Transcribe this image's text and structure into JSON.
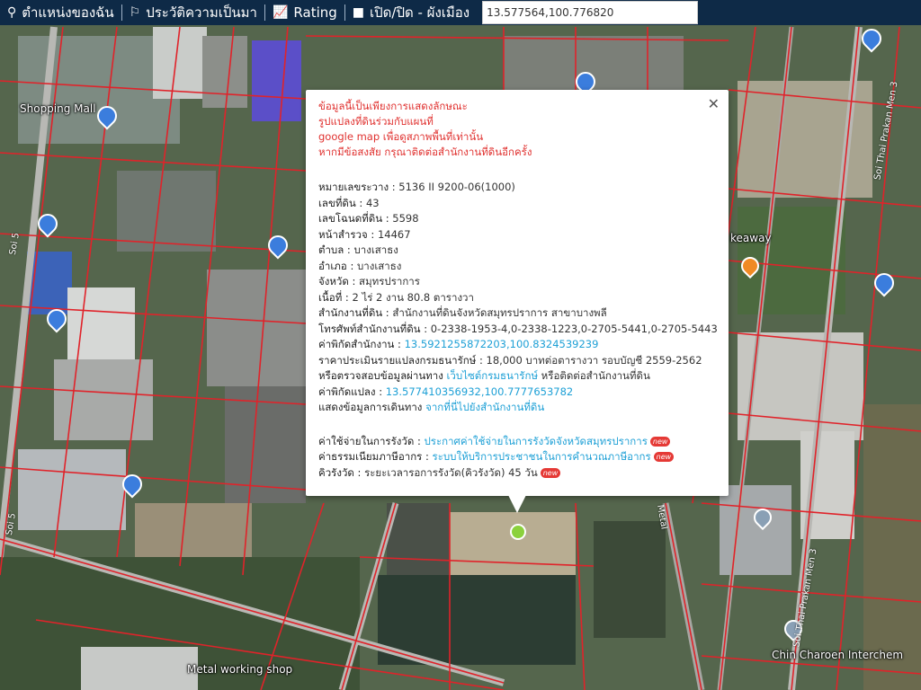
{
  "toolbar": {
    "my_location": "ตำแหน่งของฉัน",
    "history": "ประวัติความเป็นมา",
    "rating": "Rating",
    "toggle_layout": "เปิด/ปิด - ผังเมือง",
    "coordinate_value": "13.577564,100.776820"
  },
  "map_labels": {
    "shopping_mall": "Shopping Mall",
    "soi5_left": "Soi 5",
    "soi5_bottom": "Soi 5",
    "metal_shop": "Metal working shop",
    "chin_charoen": "Chin Charoen Interchem",
    "soi_prakan_men3_top": "Soi Thai Prakan Men 3",
    "soi_prakan_men3_bottom": "Soi Thai Prakan Men 3",
    "metal_road": "Metal",
    "keaway": "keaway"
  },
  "popup": {
    "notice_line1": "ข้อมูลนี้เป็นเพียงการแสดงลักษณะ",
    "notice_line2": "รูปแปลงที่ดินร่วมกับแผนที่",
    "notice_line3a": "google map",
    "notice_line3b": " เพื่อดูสภาพพื้นที่เท่านั้น",
    "notice_line4": "หากมีข้อสงสัย กรุณาติดต่อสำนักงานที่ดินอีกครั้ง",
    "r1_k": "หมายเลขระวาง : ",
    "r1_v": "5136 II 9200-06(1000)",
    "r2_k": "เลขที่ดิน : ",
    "r2_v": "43",
    "r3_k": "เลขโฉนดที่ดิน : ",
    "r3_v": "5598",
    "r4_k": "หน้าสำรวจ : ",
    "r4_v": "14467",
    "r5_k": "ตำบล : ",
    "r5_v": "บางเสาธง",
    "r6_k": "อำเภอ : ",
    "r6_v": "บางเสาธง",
    "r7_k": "จังหวัด : ",
    "r7_v": "สมุทรปราการ",
    "r8_k": "เนื้อที่ : ",
    "r8_v": "2 ไร่ 2 งาน 80.8 ตารางวา",
    "r9_k": "สำนักงานที่ดิน : ",
    "r9_v": "สำนักงานที่ดินจังหวัดสมุทรปราการ สาขาบางพลี",
    "r10_k": "โทรศัพท์สำนักงานที่ดิน : ",
    "r10_v": "0-2338-1953-4,0-2338-1223,0-2705-5441,0-2705-5443",
    "r11_k": "ค่าพิกัดสำนักงาน : ",
    "r11_v": "13.5921255872203,100.8324539239",
    "r12_k": "ราคาประเมินรายแปลงกรมธนารักษ์ : ",
    "r12_v": "18,000 บาทต่อตารางวา รอบบัญชี 2559-2562",
    "r13_k": "หรือตรวจสอบข้อมูลผ่านทาง ",
    "r13_link": "เว็บไซต์กรมธนารักษ์",
    "r13_v": " หรือติดต่อสำนักงานที่ดิน",
    "r14_k": "ค่าพิกัดแปลง : ",
    "r14_v": "13.577410356932,100.7777653782",
    "r15_k": "แสดงข้อมูลการเดินทาง ",
    "r15_link": "จากที่นี่ไปยังสำนักงานที่ดิน",
    "f1_k": "ค่าใช้จ่ายในการรังวัด : ",
    "f1_link": "ประกาศค่าใช้จ่ายในการรังวัดจังหวัดสมุทรปราการ",
    "f2_k": "ค่าธรรมเนียมภาษีอากร : ",
    "f2_link": "ระบบให้บริการประชาชนในการคำนวณภาษีอากร",
    "f3_k": "คิวรังวัด : ",
    "f3_v": "ระยะเวลารอการรังวัด(คิวรังวัด) 45 วัน",
    "new_badge": "new"
  }
}
